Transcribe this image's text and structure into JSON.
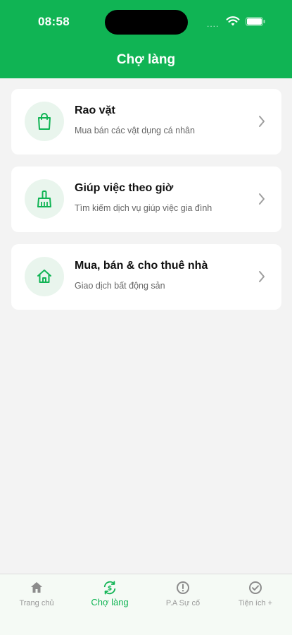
{
  "status_bar": {
    "time": "08:58",
    "signal": "....",
    "wifi_icon": "wifi-icon",
    "battery_icon": "battery-icon"
  },
  "header": {
    "title": "Chợ làng"
  },
  "colors": {
    "brand": "#10b454",
    "icon_bg": "#e9f5ed"
  },
  "cards": [
    {
      "title": "Rao vặt",
      "subtitle": "Mua bán các vật dụng cá nhân",
      "icon": "shopping-bag-icon"
    },
    {
      "title": "Giúp việc theo giờ",
      "subtitle": "Tìm kiếm dịch vụ giúp việc gia đình",
      "icon": "broom-icon"
    },
    {
      "title": "Mua, bán & cho thuê nhà",
      "subtitle": "Giao dịch bất động sản",
      "icon": "house-icon"
    }
  ],
  "tabs": [
    {
      "label": "Trang chủ",
      "icon": "home-icon",
      "active": false
    },
    {
      "label": "Chợ làng",
      "icon": "market-exchange-icon",
      "active": true
    },
    {
      "label": "P.A Sự cố",
      "icon": "alert-icon",
      "active": false
    },
    {
      "label": "Tiện ích +",
      "icon": "check-circle-icon",
      "active": false
    }
  ]
}
